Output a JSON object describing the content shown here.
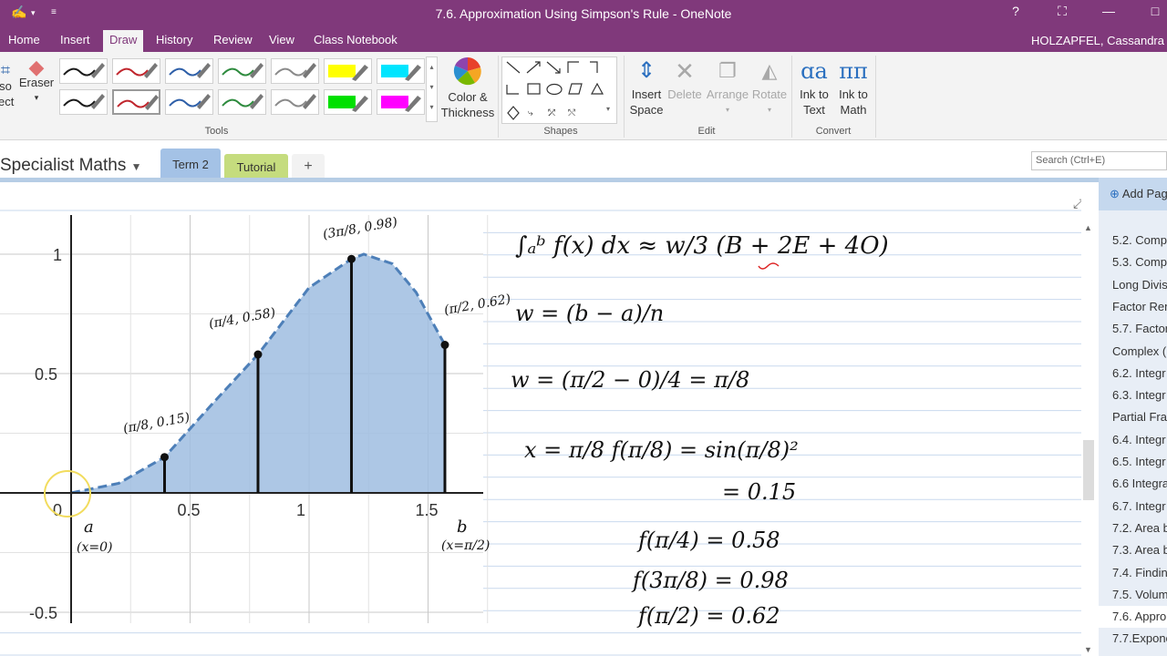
{
  "window": {
    "title": "7.6. Approximation Using Simpson's Rule - OneNote",
    "help": "?",
    "minimize": "—",
    "close_hint": "□"
  },
  "menu": {
    "tabs": [
      "Home",
      "Insert",
      "Draw",
      "History",
      "Review",
      "View",
      "Class Notebook"
    ],
    "active": "Draw",
    "user": "HOLZAPFEL, Cassandra"
  },
  "ribbon": {
    "lasso_label": "so",
    "lasso_label2": "ect",
    "eraser_label": "Eraser",
    "color_thickness_1": "Color &",
    "color_thickness_2": "Thickness",
    "tools_label": "Tools",
    "shapes_label": "Shapes",
    "insert_space_1": "Insert",
    "insert_space_2": "Space",
    "delete_label": "Delete",
    "arrange_label": "Arrange",
    "rotate_label": "Rotate",
    "edit_label": "Edit",
    "ink_to_text_1": "Ink to",
    "ink_to_text_2": "Text",
    "ink_to_math_1": "Ink to",
    "ink_to_math_2": "Math",
    "convert_label": "Convert",
    "pen_colors": [
      "#1a1a1a",
      "#c0262d",
      "#2e5fa8",
      "#2e8b3e",
      "#8a8a8a",
      "#ffff00",
      "#00e5ff",
      "#1a1a1a",
      "#c0262d",
      "#2e5fa8",
      "#2e8b3e",
      "#8a8a8a",
      "#00e000",
      "#ff00ff"
    ]
  },
  "sections": {
    "notebook": "Specialist Maths",
    "tabs": [
      {
        "label": "Term 2",
        "color": "#a4c2e6"
      },
      {
        "label": "Tutorial",
        "color": "#c5dc7e"
      },
      {
        "label": "+",
        "color": "#f2f2f2"
      }
    ],
    "search_placeholder": "Search (Ctrl+E)"
  },
  "pages": {
    "add_page": "Add Page",
    "items": [
      "5.2. Comp",
      "5.3. Comp",
      "Long Divis",
      "Factor Rem",
      "5.7. Factor",
      "Complex (",
      "6.2. Integr",
      "6.3. Integr",
      "Partial Frac",
      "6.4. Integr",
      "6.5. Integr",
      "6.6 Integra",
      "6.7. Integr",
      "7.2. Area b",
      "7.3. Area b",
      "7.4. Findin",
      "7.5. Volum",
      "7.6. Appro",
      "7.7.Expone"
    ],
    "selected_index": 17
  },
  "graph": {
    "y_ticks": [
      "1",
      "0.5",
      "-0.5"
    ],
    "x_ticks": [
      "0",
      "0.5",
      "1",
      "1.5"
    ],
    "points": [
      {
        "label": "(π/8, 0.15)",
        "x": 0.3927,
        "y": 0.15
      },
      {
        "label": "(π/4, 0.58)",
        "x": 0.7854,
        "y": 0.58
      },
      {
        "label": "(3π/8, 0.98)",
        "x": 1.1781,
        "y": 0.98
      },
      {
        "label": "(π/2, 0.62)",
        "x": 1.5708,
        "y": 0.62
      }
    ],
    "a_label": "a",
    "a_note": "(x=0)",
    "b_label": "b",
    "b_note": "(x=π/2)"
  },
  "notes": {
    "line1": "∫ₐᵇ f(x) dx ≈ w/3 (B + 2E + 4O)",
    "line2": "w = (b − a)/n",
    "line3": "w = (π/2 − 0)/4 = π/8",
    "line4": "x = π/8     f(π/8) = sin(π/8)²",
    "line5": "= 0.15",
    "line6": "f(π/4) = 0.58",
    "line7": "f(3π/8) = 0.98",
    "line8": "f(π/2) = 0.62"
  }
}
